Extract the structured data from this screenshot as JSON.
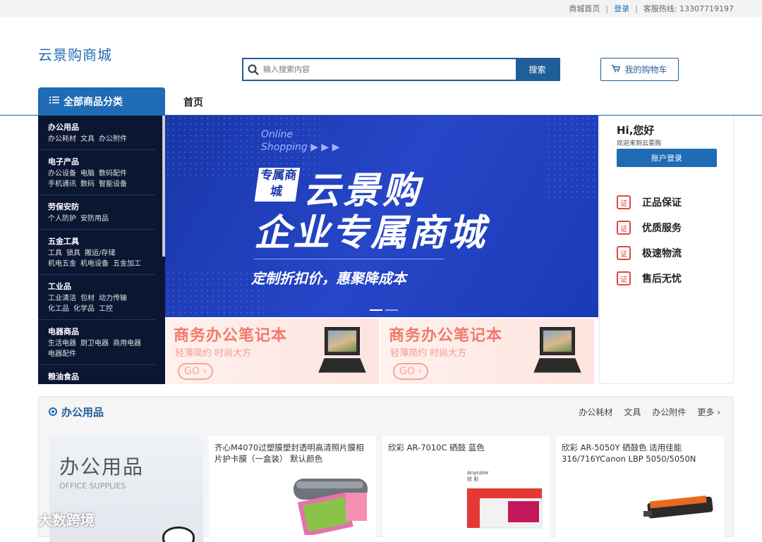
{
  "topbar": {
    "home": "商城首页",
    "sep1": "|",
    "login": "登录",
    "sep2": "|",
    "hotline": "客服热线: 13307719197"
  },
  "header": {
    "logo": "云景购商城",
    "search_placeholder": "输入搜索内容",
    "search_button": "搜索",
    "cart": "我的购物车"
  },
  "nav": {
    "all_categories": "全部商品分类",
    "home": "首页"
  },
  "categories": [
    {
      "title": "办公用品",
      "subs": [
        "办公耗材",
        "文具",
        "办公附件"
      ]
    },
    {
      "title": "电子产品",
      "subs": [
        "办公设备",
        "电脑",
        "数码配件",
        "手机通讯",
        "数码",
        "智能设备"
      ]
    },
    {
      "title": "劳保安防",
      "subs": [
        "个人防护",
        "安防用品"
      ]
    },
    {
      "title": "五金工具",
      "subs": [
        "工具",
        "锁具",
        "搬运/存储",
        "机电五金",
        "机电设备",
        "五金加工"
      ]
    },
    {
      "title": "工业品",
      "subs": [
        "工业清洁",
        "包材",
        "动力传输",
        "化工品",
        "化学品",
        "工控"
      ]
    },
    {
      "title": "电器商品",
      "subs": [
        "生活电器",
        "厨卫电器",
        "商用电器",
        "电器配件"
      ]
    },
    {
      "title": "粮油食品",
      "subs": []
    }
  ],
  "banner": {
    "online": "Online",
    "shopping": "Shopping ▶ ▶ ▶",
    "tag": "专属商城",
    "title1": "云景购",
    "title2": "企业专属商城",
    "slogan": "定制折扣价，惠聚降成本"
  },
  "promos": [
    {
      "title": "商务办公笔记本",
      "sub": "轻薄简约 时尚大方",
      "go": "GO ›"
    },
    {
      "title": "商务办公笔记本",
      "sub": "轻薄简约 时尚大方",
      "go": "GO ›"
    }
  ],
  "side": {
    "hi": "Hi,您好",
    "welcome": "欢迎来到云景购",
    "login_button": "账户登录",
    "features": [
      {
        "icon": "证",
        "label": "正品保证"
      },
      {
        "icon": "证",
        "label": "优质服务"
      },
      {
        "icon": "证",
        "label": "极速物流"
      },
      {
        "icon": "证",
        "label": "售后无忧"
      }
    ]
  },
  "floor": {
    "title": "办公用品",
    "links": [
      "办公耗材",
      "文具",
      "办公附件",
      "更多 ›"
    ],
    "big_cn": "办公用品",
    "big_en": "OFFICE SUPPLIES",
    "products": [
      {
        "name": "齐心M4070过塑膜塑封透明高清照片膜相片护卡膜（一盒装） 默认颜色"
      },
      {
        "name": "欣彩 AR-7010C 硒鼓 蓝色"
      },
      {
        "name": "欣彩 AR-5050Y 硒鼓色 适用佳能316/716YCanon LBP 5050/5050N"
      }
    ]
  },
  "watermark": "大数跨境",
  "colors": {
    "primary": "#1f6bb5",
    "dark_nav": "#0b1633",
    "banner": "#1f3fbf",
    "accent_red": "#e2463f"
  }
}
